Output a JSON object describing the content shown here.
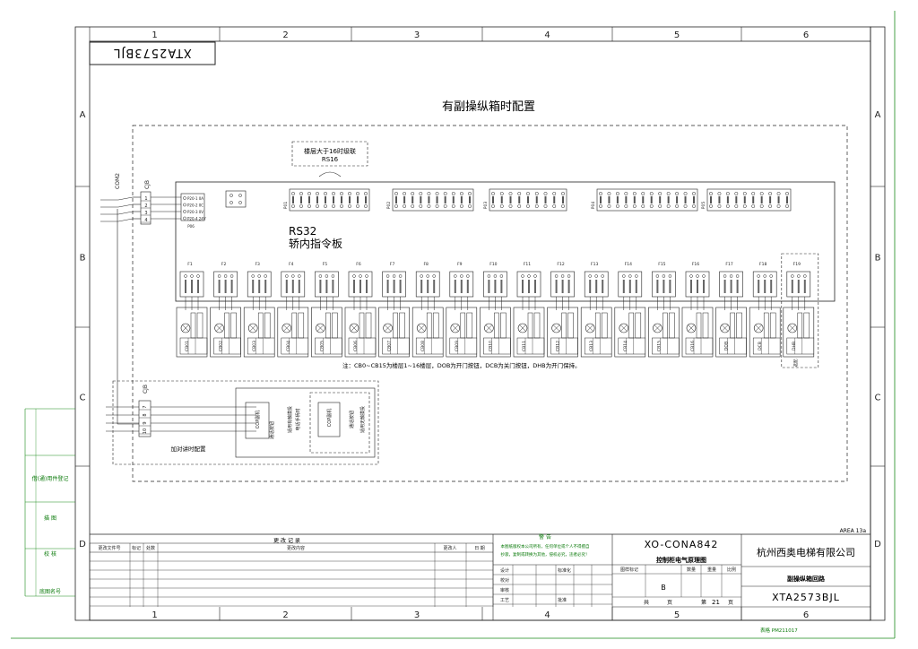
{
  "drawing": {
    "col_labels": [
      "1",
      "2",
      "3",
      "4",
      "5",
      "6"
    ],
    "row_labels": [
      "A",
      "B",
      "C",
      "D"
    ],
    "mirror_code": "XTA2573BJL",
    "title": "有副操纵箱时配置",
    "area_label": "AREA 13a",
    "board": {
      "name": "RS32",
      "desc": "轿内指令板",
      "cascade_note_line1": "楼层大于16时级联",
      "cascade_note_line2": "RS16",
      "top_connector_labels": [
        "P01",
        "P02",
        "P03",
        "P04",
        "P05"
      ],
      "power_connector_label": "P06",
      "power_pin_labels": [
        "P20-1 0A",
        "P20-2 0C",
        "P20-3 0V",
        "P20-4 24V"
      ],
      "cjb_label": "CJB",
      "cjb_pins": [
        "1",
        "2",
        "3",
        "4"
      ],
      "cable_label": "COM2",
      "floor_ports": [
        "F1",
        "F2",
        "F3",
        "F4",
        "F5",
        "F6",
        "F7",
        "F8",
        "F9",
        "F10",
        "F11",
        "F12",
        "F13",
        "F14",
        "F15",
        "F16",
        "F17",
        "F18",
        "F19"
      ],
      "button_codes": [
        "CB01",
        "CB02",
        "CB03",
        "CB04",
        "CB05",
        "CB06",
        "CB07",
        "CB08",
        "CB09",
        "CB10",
        "CB11",
        "CB12",
        "CB13",
        "CB14",
        "CB15",
        "CB16",
        "DOB",
        "DCB",
        "DHB"
      ],
      "hold_label": "选配"
    },
    "note": "注：CB0~CB15为楼层1~16楼层，DOB为开门按钮，DCB为关门按钮，DHB为开门保持。",
    "intercom": {
      "cjb_label": "CJB",
      "cjb_pins": [
        "7",
        "8",
        "9",
        "10"
      ],
      "unit1_label": "COP副机",
      "unit1_button": "通话按钮",
      "unit1_caption": "适用有触摸投\n电话手柄时",
      "unit2_label": "COP副机",
      "unit2_button": "通话按钮",
      "unit2_caption": "适用无触摸投",
      "config_note": "加对讲时配置"
    }
  },
  "left_strip": {
    "labels": [
      "借(通)用件登记",
      "描 图",
      "校 核",
      "底图名号"
    ]
  },
  "title_block": {
    "revision_header": "更 改 记 录",
    "rev_cols": [
      "更改文件号",
      "标记",
      "处数",
      "更改内容",
      "更改人",
      "日 期"
    ],
    "warning_title": "警 告",
    "warning_text_1": "本图纸版权本公司所有，任何单位或个人不得擅自",
    "warning_text_2": "抄袭，复制或转换为其他，侵权必究，违者必究！",
    "sign_rows": [
      "设计",
      "校对",
      "审核",
      "工艺"
    ],
    "sign_mid": [
      "标准化",
      "",
      "",
      "批准"
    ],
    "drawing_no": "XO-CONA842",
    "drawing_name": "控制柜电气原理图",
    "company": "杭州西奥电梯有限公司",
    "attr_headers": [
      "图样标记",
      "数量",
      "重量",
      "比例"
    ],
    "stage_mark": "B",
    "sheet_total_label": "共",
    "sheet_unit": "页",
    "sheet_label": "第",
    "sheet_no": "21",
    "sheet_unit2": "页",
    "sub_title": "副操纵箱回路",
    "code": "XTA2573BJL",
    "format_note": "表格 PM211017"
  }
}
